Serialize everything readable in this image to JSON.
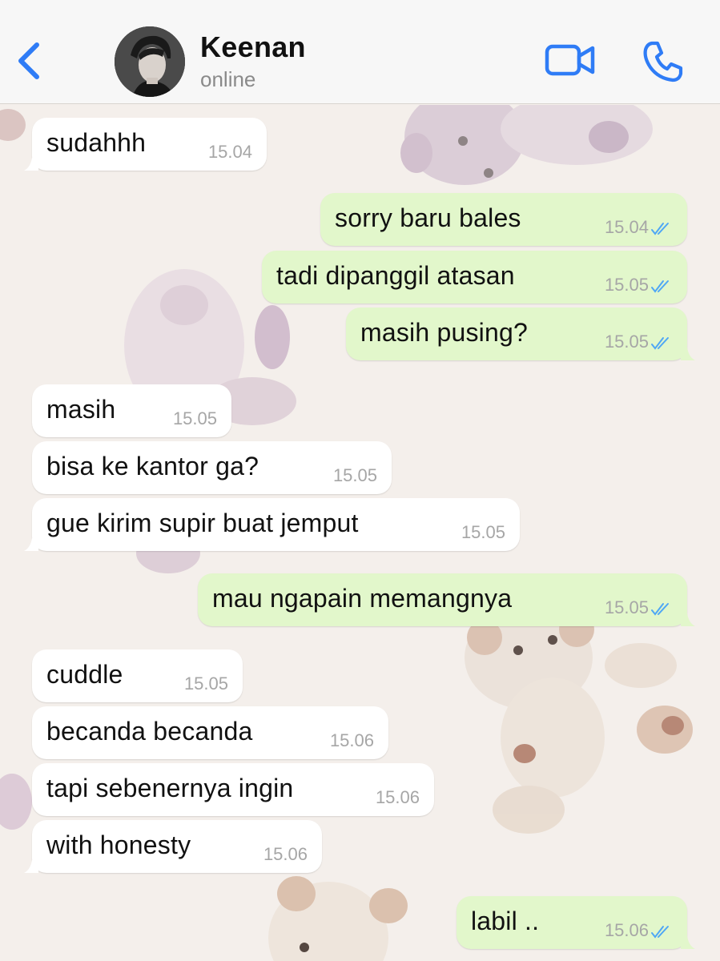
{
  "header": {
    "contact_name": "Keenan",
    "status": "online",
    "back_icon": "chevron-left-icon",
    "video_icon": "video-camera-icon",
    "call_icon": "phone-icon"
  },
  "colors": {
    "accent": "#2f7cf6",
    "incoming_bubble": "#ffffff",
    "outgoing_bubble": "#e2f7cb",
    "read_ticks": "#4fa7f5",
    "background": "#f4efeb"
  },
  "messages": [
    {
      "dir": "in",
      "text": "sudahhh",
      "time": "15.04"
    },
    {
      "dir": "out",
      "text": "sorry baru bales",
      "time": "15.04",
      "read": true
    },
    {
      "dir": "out",
      "text": "tadi dipanggil atasan",
      "time": "15.05",
      "read": true
    },
    {
      "dir": "out",
      "text": "masih pusing?",
      "time": "15.05",
      "read": true
    },
    {
      "dir": "in",
      "text": "masih",
      "time": "15.05"
    },
    {
      "dir": "in",
      "text": "bisa ke kantor ga?",
      "time": "15.05"
    },
    {
      "dir": "in",
      "text": "gue kirim supir buat jemput",
      "time": "15.05"
    },
    {
      "dir": "out",
      "text": "mau ngapain memangnya",
      "time": "15.05",
      "read": true
    },
    {
      "dir": "in",
      "text": "cuddle",
      "time": "15.05"
    },
    {
      "dir": "in",
      "text": "becanda becanda",
      "time": "15.06"
    },
    {
      "dir": "in",
      "text": "tapi sebenernya ingin",
      "time": "15.06"
    },
    {
      "dir": "in",
      "text": "with honesty",
      "time": "15.06"
    },
    {
      "dir": "out",
      "text": "labil ..",
      "time": "15.06",
      "read": true
    }
  ]
}
